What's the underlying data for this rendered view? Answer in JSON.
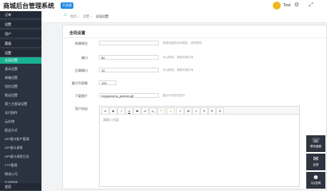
{
  "header": {
    "title": "商城后台管理系统",
    "badge": "开发版",
    "username": "Test"
  },
  "sidebar": {
    "items": [
      {
        "label": "订单",
        "type": "group"
      },
      {
        "label": "设置",
        "type": "group"
      },
      {
        "label": "用户",
        "type": "group"
      },
      {
        "label": "渠道",
        "type": "group"
      },
      {
        "label": "设置",
        "type": "group"
      },
      {
        "label": "全局设置",
        "type": "active"
      },
      {
        "label": "基本设置",
        "type": "item"
      },
      {
        "label": "邮箱设置",
        "type": "item"
      },
      {
        "label": "短信设置",
        "type": "item"
      },
      {
        "label": "推送设置",
        "type": "item"
      },
      {
        "label": "第三方登录设置",
        "type": "item"
      },
      {
        "label": "支付插件",
        "type": "item"
      },
      {
        "label": "云存储",
        "type": "item"
      },
      {
        "label": "配送方式",
        "type": "item"
      },
      {
        "label": "API接口账户管理",
        "type": "item"
      },
      {
        "label": "API接口调用",
        "type": "item"
      },
      {
        "label": "API接口调用日志",
        "type": "item"
      },
      {
        "label": "FTP管理",
        "type": "item"
      },
      {
        "label": "物流公司",
        "type": "item"
      },
      {
        "label": "区域管理",
        "type": "item"
      },
      {
        "label": "会员",
        "type": "group"
      }
    ]
  },
  "breadcrumb": {
    "home": "首页",
    "sep1": "›",
    "level1": "设置",
    "sep2": "›",
    "level2": "全局设置"
  },
  "panel": {
    "title": "全局设置"
  },
  "form": {
    "fields": [
      {
        "label": "前端域名",
        "value": "",
        "hint": "前端页面的访问域名，请勿修改"
      },
      {
        "label": "端口",
        "value": "80",
        "hint": "可以修改，请填写端口号"
      },
      {
        "label": "后端端口",
        "value": "10",
        "hint": "可以修改，请填写端口号"
      },
      {
        "label": "最大列表数",
        "value": "100",
        "hint": ""
      },
      {
        "label": "下载图片",
        "value": "/ri/ppu/ui/no_picture.gif",
        "hint": "图片不存在时显示"
      }
    ],
    "editor_label": "用户协议",
    "editor_placeholder": "请输入内容",
    "toolbar": [
      "H",
      "B",
      "I",
      "U",
      "S",
      "x²",
      "x₂",
      "\"\"",
      "A",
      "≡",
      "⊞",
      "☺",
      "✎",
      "⇱",
      "↻"
    ]
  },
  "floating": [
    {
      "label": "联系客服",
      "icon": "headset-icon"
    },
    {
      "label": "反馈",
      "icon": "chat-icon"
    },
    {
      "label": "QQ咨询",
      "icon": "qq-icon"
    }
  ],
  "colors": {
    "sidebar_bg": "#2b3240",
    "active": "#19b394",
    "accent": "#1e88e5"
  }
}
